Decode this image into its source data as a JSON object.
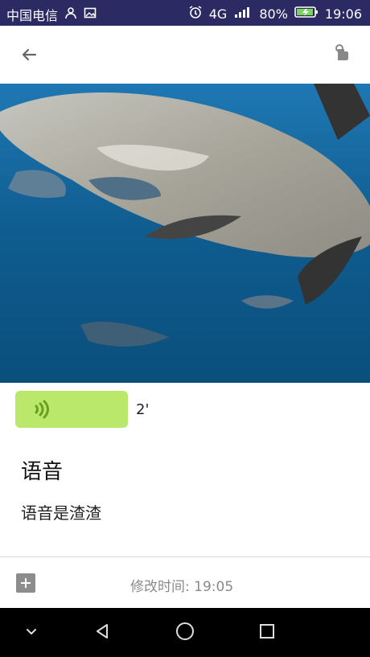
{
  "status_bar": {
    "carrier": "中国电信",
    "network": "4G",
    "battery_percent": "80%",
    "time": "19:06",
    "icons": [
      "person-icon",
      "image-icon",
      "alarm-icon",
      "signal-icon",
      "battery-icon"
    ]
  },
  "app_bar": {
    "back_icon": "arrow-left-icon",
    "action_icon": "touch-icon"
  },
  "note": {
    "voice_duration": "2'",
    "title": "语音",
    "content": "语音是渣渣",
    "modified_label": "修改时间:",
    "modified_time": "19:05"
  },
  "colors": {
    "status_bar": "#2b2a63",
    "voice_bubble": "#b9e86b",
    "voice_wave": "#6a9d20"
  },
  "nav_bar": {
    "icons": [
      "chevron-down-icon",
      "back-triangle-icon",
      "home-circle-icon",
      "recent-square-icon"
    ]
  }
}
